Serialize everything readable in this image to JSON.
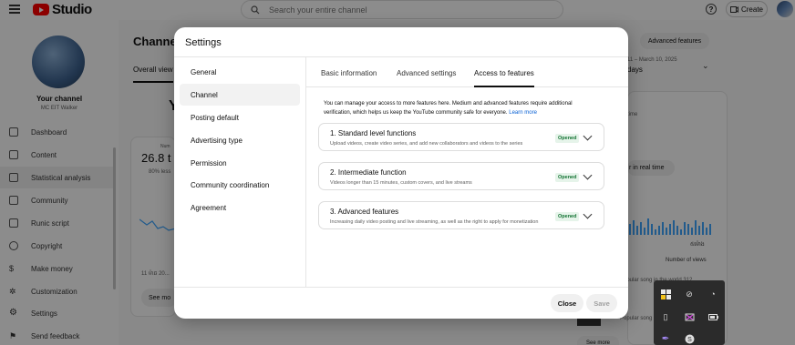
{
  "topbar": {
    "logo_text": "Studio",
    "search_placeholder": "Search your entire channel",
    "help_icon": "?",
    "create_label": "Create"
  },
  "sidebar": {
    "channel_name": "Your channel",
    "channel_sub": "MC EIT Walker",
    "items": [
      {
        "label": "Dashboard",
        "icon": "grid-icon"
      },
      {
        "label": "Content",
        "icon": "play-icon"
      },
      {
        "label": "Statistical analysis",
        "icon": "bar-chart-icon",
        "active": true
      },
      {
        "label": "Community",
        "icon": "people-icon"
      },
      {
        "label": "Runic script",
        "icon": "subtitles-icon"
      },
      {
        "label": "Copyright",
        "icon": "copyright-icon"
      },
      {
        "label": "Make money",
        "icon": "dollar-icon"
      },
      {
        "label": "Customization",
        "icon": "wand-icon"
      },
      {
        "label": "Settings",
        "icon": "gear-icon"
      },
      {
        "label": "Send feedback",
        "icon": "flag-icon"
      }
    ]
  },
  "main": {
    "title": "Channel",
    "tab": "Overall view",
    "heading_fragment": "Y",
    "card_value": "26.8 t",
    "card_sub": "80% less",
    "card_small": "Num",
    "card_date": "11 ម៉ាឆ 20...",
    "see_more": "See mo"
  },
  "right": {
    "advanced_features": "Advanced features",
    "date_range": "11 – March 10, 2025",
    "date_days": "days",
    "rt_label": "time",
    "realtime": "r in real time",
    "kh_label": "៥ម៉ោង",
    "views_label": "Number of views",
    "row1": "Popular song in the world    312",
    "row2": "Popular song in the",
    "see_more": "See more"
  },
  "modal": {
    "title": "Settings",
    "nav": [
      "General",
      "Channel",
      "Posting default",
      "Advertising type",
      "Permission",
      "Community coordination",
      "Agreement"
    ],
    "active_nav": "Channel",
    "tabs": [
      "Basic information",
      "Advanced settings",
      "Access to features"
    ],
    "active_tab": "Access to features",
    "intro_text": "You can manage your access to more features here. Medium and advanced features require additional verification, which helps us keep the YouTube community safe for everyone.",
    "intro_link": "Learn more",
    "features": [
      {
        "title": "1. Standard level functions",
        "desc": "Upload videos, create video series, and add new collaborators and videos to the series",
        "badge": "Opened"
      },
      {
        "title": "2. Intermediate function",
        "desc": "Videos longer than 15 minutes, custom covers, and live streams",
        "badge": "Opened"
      },
      {
        "title": "3. Advanced features",
        "desc": "Increasing daily video posting and live streaming, as well as the right to apply for monetization",
        "badge": "Opened"
      }
    ],
    "close_label": "Close",
    "save_label": "Save"
  },
  "tray": {
    "icons": [
      "security-shield-icon",
      "network-off-icon",
      "wifi-icon",
      "usb-icon",
      "media-icon",
      "battery-icon",
      "pen-icon",
      "skype-icon"
    ]
  },
  "colors": {
    "brand_red": "#ff0000",
    "link_blue": "#065fd4",
    "badge_green_bg": "#e6f4ea",
    "badge_green_text": "#137333"
  }
}
